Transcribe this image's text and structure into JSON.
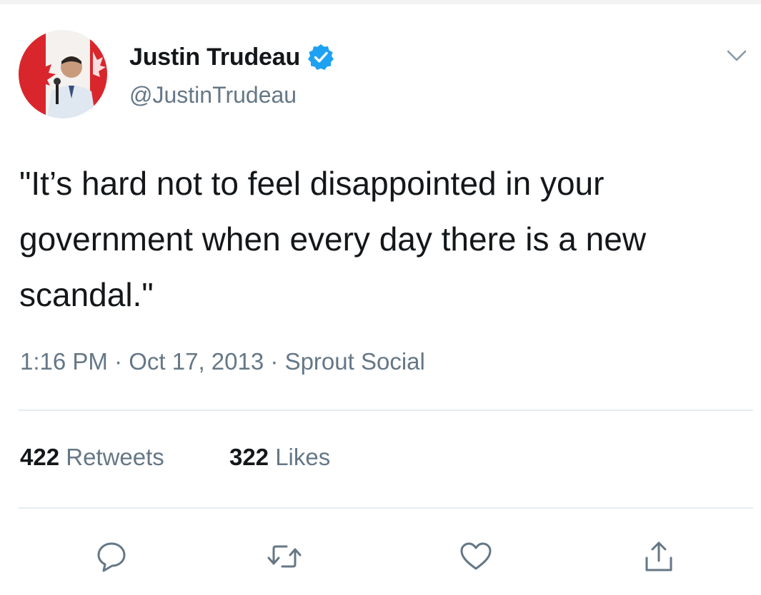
{
  "author": {
    "display_name": "Justin Trudeau",
    "handle": "@JustinTrudeau",
    "verified": true
  },
  "tweet": {
    "text": "\"It’s hard not to feel disappointed in your government when every day there is a new scandal.\"",
    "time": "1:16 PM",
    "date": "Oct 17, 2013",
    "source": "Sprout Social",
    "separator": "·"
  },
  "stats": {
    "retweets_count": "422",
    "retweets_label": "Retweets",
    "likes_count": "322",
    "likes_label": "Likes"
  },
  "icons": {
    "caret": "chevron-down-icon",
    "verified": "verified-badge-icon",
    "reply": "reply-icon",
    "retweet": "retweet-icon",
    "like": "heart-icon",
    "share": "share-icon"
  },
  "colors": {
    "text_primary": "#14171a",
    "text_secondary": "#657786",
    "verified_blue": "#1da1f2",
    "divider": "#e6ecf0",
    "icon_gray": "#657786"
  }
}
